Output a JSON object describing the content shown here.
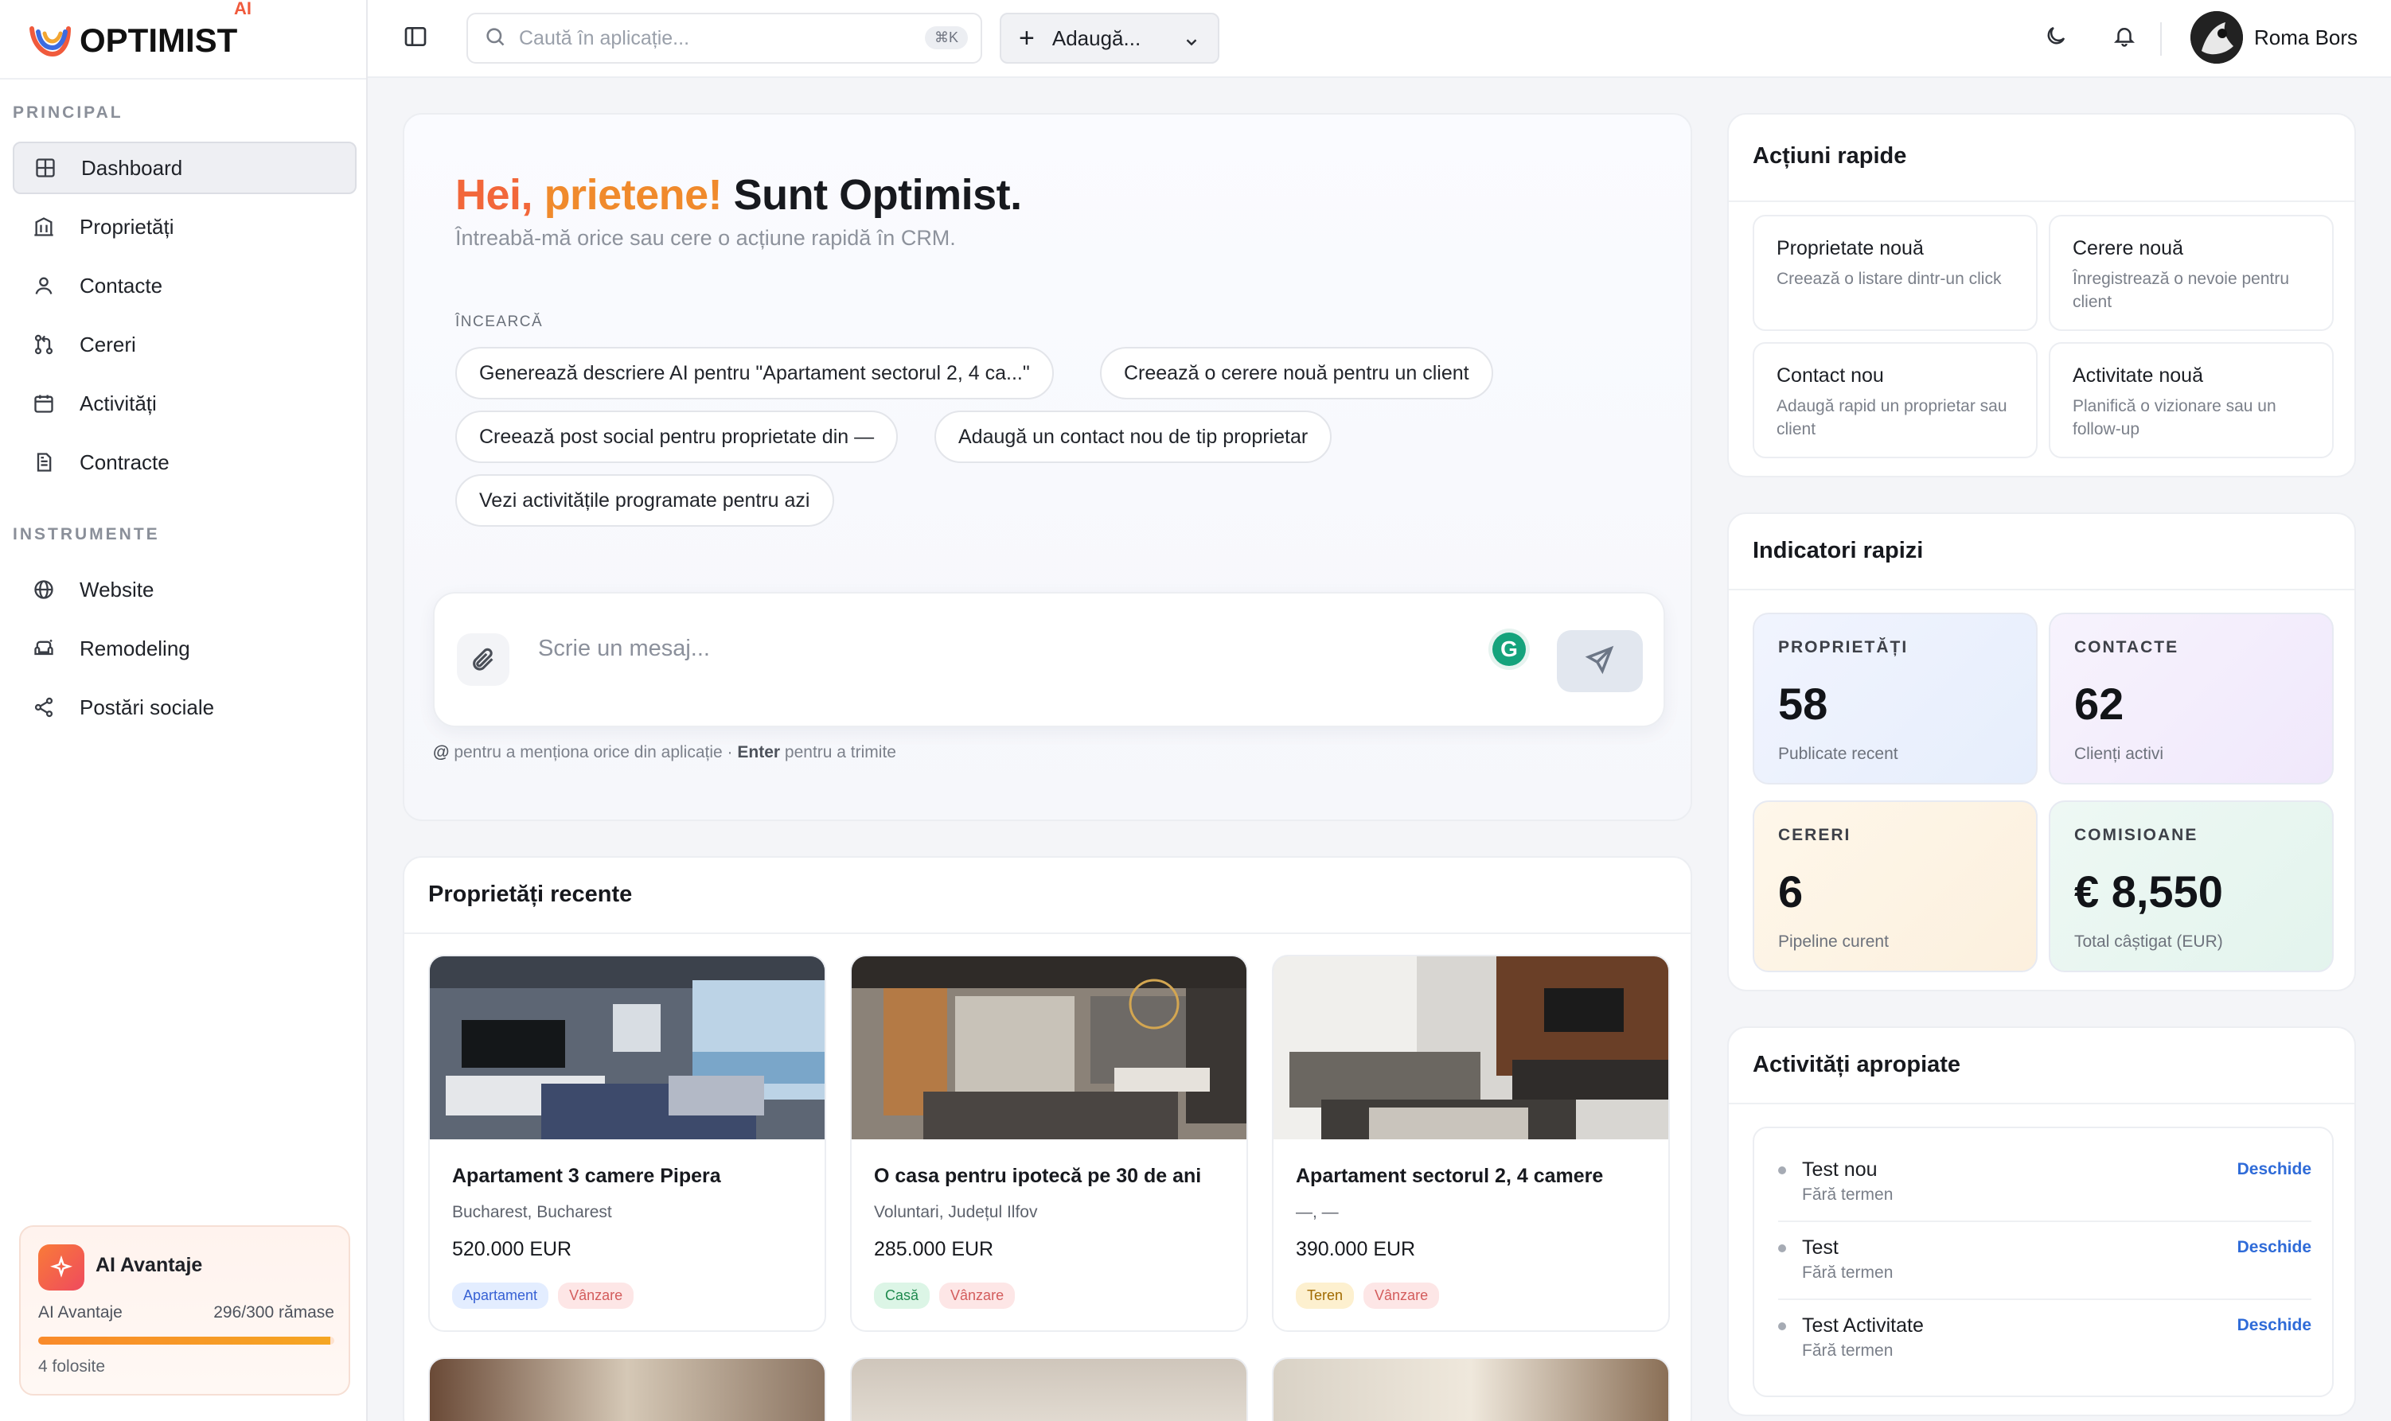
{
  "brand": {
    "name": "OPTIMIST",
    "suffix": "AI"
  },
  "sidebar": {
    "section_principal": "PRINCIPAL",
    "items": [
      {
        "label": "Dashboard",
        "icon": "grid-icon"
      },
      {
        "label": "Proprietăți",
        "icon": "building-icon"
      },
      {
        "label": "Contacte",
        "icon": "user-icon"
      },
      {
        "label": "Cereri",
        "icon": "pull-request-icon"
      },
      {
        "label": "Activități",
        "icon": "calendar-icon"
      },
      {
        "label": "Contracte",
        "icon": "document-icon"
      }
    ],
    "section_tools": "INSTRUMENTE",
    "tools": [
      {
        "label": "Website",
        "icon": "globe-icon"
      },
      {
        "label": "Remodeling",
        "icon": "sofa-icon"
      },
      {
        "label": "Postări sociale",
        "icon": "share-icon"
      }
    ],
    "ai_card": {
      "title": "AI Avantaje",
      "row_label": "AI Avantaje",
      "remaining": "296/300 rămase",
      "used": "4 folosite",
      "progress_fraction": 0.987
    }
  },
  "topbar": {
    "search_placeholder": "Caută în aplicație...",
    "shortcut": "⌘K",
    "add_label": "Adaugă...",
    "user_name": "Roma Bors"
  },
  "hero": {
    "greeting_part1": "Hei,",
    "greeting_part2": "prietene!",
    "greeting_part3": "Sunt Optimist.",
    "subtitle": "Întreabă-mă orice sau cere o acțiune rapidă în CRM.",
    "try_label": "ÎNCEARCĂ",
    "chips": [
      "Generează descriere AI pentru \"Apartament sectorul 2, 4 ca...\"",
      "Creează o cerere nouă pentru un client",
      "Creează post social pentru proprietate din —",
      "Adaugă un contact nou de tip proprietar",
      "Vezi activitățile programate pentru azi"
    ],
    "message_placeholder": "Scrie un mesaj...",
    "hint_at": "@",
    "hint_text1": "pentru a menționa orice din aplicație ·",
    "hint_enter": "Enter",
    "hint_text2": "pentru a trimite"
  },
  "recent": {
    "title": "Proprietăți recente",
    "properties": [
      {
        "title": "Apartament 3 camere Pipera",
        "location": "Bucharest, Bucharest",
        "price": "520.000 EUR",
        "type": "Apartament",
        "deal": "Vânzare"
      },
      {
        "title": "O casa pentru ipotecă pe 30 de ani",
        "location": "Voluntari, Județul Ilfov",
        "price": "285.000 EUR",
        "type": "Casă",
        "deal": "Vânzare"
      },
      {
        "title": "Apartament sectorul 2, 4 camere",
        "location": "—, —",
        "price": "390.000 EUR",
        "type": "Teren",
        "deal": "Vânzare"
      }
    ]
  },
  "quick_actions": {
    "title": "Acțiuni rapide",
    "items": [
      {
        "title": "Proprietate nouă",
        "desc": "Creează o listare dintr-un click"
      },
      {
        "title": "Cerere nouă",
        "desc": "Înregistrează o nevoie pentru client"
      },
      {
        "title": "Contact nou",
        "desc": "Adaugă rapid un proprietar sau client"
      },
      {
        "title": "Activitate nouă",
        "desc": "Planifică o vizionare sau un follow-up"
      }
    ]
  },
  "indicators": {
    "title": "Indicatori rapizi",
    "items": [
      {
        "label": "PROPRIETĂȚI",
        "value": "58",
        "sub": "Publicate recent"
      },
      {
        "label": "CONTACTE",
        "value": "62",
        "sub": "Clienți activi"
      },
      {
        "label": "CERERI",
        "value": "6",
        "sub": "Pipeline curent"
      },
      {
        "label": "COMISIOANE",
        "value": "€ 8,550",
        "sub": "Total câștigat (EUR)"
      }
    ]
  },
  "activities": {
    "title": "Activități apropiate",
    "items": [
      {
        "title": "Test nou",
        "sub": "Fără termen",
        "action": "Deschide"
      },
      {
        "title": "Test",
        "sub": "Fără termen",
        "action": "Deschide"
      },
      {
        "title": "Test Activitate",
        "sub": "Fără termen",
        "action": "Deschide"
      }
    ]
  },
  "colors": {
    "accent_orange": "#f2673a",
    "accent_amber": "#f08a2c",
    "link_blue": "#2f6bd8"
  }
}
